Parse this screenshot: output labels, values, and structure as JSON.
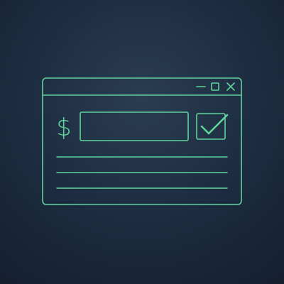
{
  "window": {
    "title_bar": {
      "controls": [
        {
          "icon": "minimize-icon"
        },
        {
          "icon": "maximize-icon"
        },
        {
          "icon": "close-icon"
        }
      ]
    },
    "content": {
      "currency_symbol": "$",
      "amount_value": "",
      "checkbox_checked": true,
      "text_lines": 3
    }
  },
  "colors": {
    "background_center": "#2b3d52",
    "background_edge": "#151f30",
    "line_accent": "#5fd39c"
  }
}
